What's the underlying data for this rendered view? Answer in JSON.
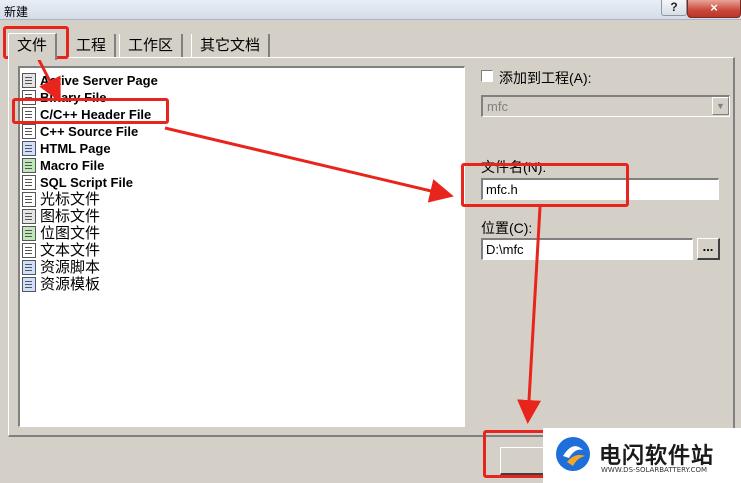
{
  "window": {
    "title": "新建",
    "help_label": "?",
    "close_label": "×"
  },
  "tabs": [
    {
      "label": "文件"
    },
    {
      "label": "工程"
    },
    {
      "label": "工作区"
    },
    {
      "label": "其它文档"
    }
  ],
  "file_types": [
    {
      "label": "Active Server Page",
      "icon": "asp-file-icon"
    },
    {
      "label": "Binary File",
      "icon": "binary-file-icon"
    },
    {
      "label": "C/C++ Header File",
      "icon": "header-file-icon"
    },
    {
      "label": "C++ Source File",
      "icon": "source-file-icon"
    },
    {
      "label": "HTML Page",
      "icon": "html-file-icon"
    },
    {
      "label": "Macro File",
      "icon": "macro-file-icon"
    },
    {
      "label": "SQL Script File",
      "icon": "sql-file-icon"
    },
    {
      "label": "光标文件",
      "icon": "cursor-file-icon"
    },
    {
      "label": "图标文件",
      "icon": "icon-file-icon"
    },
    {
      "label": "位图文件",
      "icon": "bitmap-file-icon"
    },
    {
      "label": "文本文件",
      "icon": "text-file-icon"
    },
    {
      "label": "资源脚本",
      "icon": "resource-script-icon"
    },
    {
      "label": "资源模板",
      "icon": "resource-template-icon"
    }
  ],
  "add_to_project": {
    "label": "添加到工程(A):",
    "checked": false
  },
  "project_combo": {
    "value": "mfc"
  },
  "file_name": {
    "label": "文件名(N):",
    "value": "mfc.h"
  },
  "location": {
    "label": "位置(C):",
    "value": "D:\\mfc",
    "browse_label": "..."
  },
  "ok_button": {
    "label": ""
  },
  "watermark": {
    "name": "电闪软件站",
    "url": "WWW.DS-SOLARBATTERY.COM"
  },
  "annotation_color": "#e8251c"
}
